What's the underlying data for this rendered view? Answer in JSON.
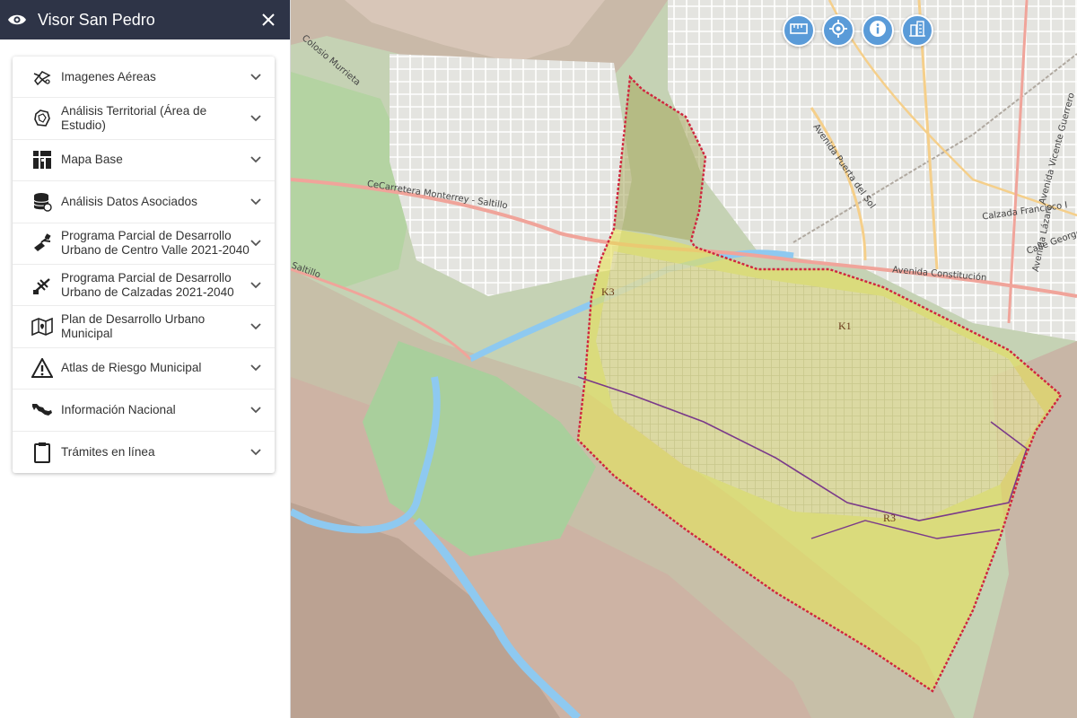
{
  "app": {
    "title": "Visor San Pedro"
  },
  "sidebar": {
    "items": [
      {
        "label": "Imagenes Aéreas",
        "icon": "drone-icon"
      },
      {
        "label": "Análisis Territorial (Área de Estudio)",
        "icon": "territory-icon"
      },
      {
        "label": "Mapa Base",
        "icon": "basemap-icon"
      },
      {
        "label": "Análisis Datos Asociados",
        "icon": "database-icon"
      },
      {
        "label": "Programa Parcial de Desarrollo Urbano de Centro Valle 2021-2040",
        "icon": "satellite-icon"
      },
      {
        "label": "Programa Parcial de Desarrollo Urbano de Calzadas 2021-2040",
        "icon": "satellite-icon"
      },
      {
        "label": "Plan de Desarrollo Urbano Municipal",
        "icon": "map-icon"
      },
      {
        "label": "Atlas de Riesgo Municipal",
        "icon": "warning-icon"
      },
      {
        "label": "Información Nacional",
        "icon": "mexico-icon"
      },
      {
        "label": "Trámites en línea",
        "icon": "clipboard-icon"
      }
    ]
  },
  "map": {
    "tools": [
      {
        "name": "measure-tool",
        "icon": "ruler-icon"
      },
      {
        "name": "locate-tool",
        "icon": "locate-icon"
      },
      {
        "name": "info-tool",
        "icon": "info-icon"
      },
      {
        "name": "buildings-tool",
        "icon": "buildings-icon"
      }
    ],
    "labels": {
      "road1": "Colosio Murrieta",
      "road2": "CeCarretera Monterrey - Saltillo",
      "road3": "Saltillo",
      "road4": "Avenida Puerta del Sol",
      "road5": "Avenida Constitución",
      "road6": "Calzada Francisco I",
      "road7": "Avenida Lázaro",
      "road8": "Calle George W",
      "road9": "Avenida Vicente Guerrero",
      "zone1": "K1",
      "zone2": "K3",
      "zone3": "R3"
    },
    "colors": {
      "boundary": "#d0263e",
      "zone_fill": "#e7e05a",
      "river": "#8ec9f0",
      "accent": "#5a9bd8",
      "topbar": "#2e3447"
    }
  }
}
